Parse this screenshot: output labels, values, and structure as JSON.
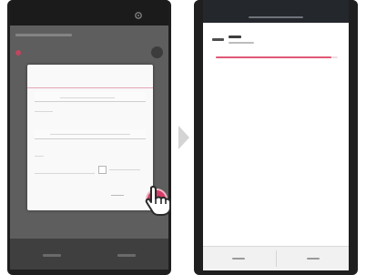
{
  "left_screen": {
    "header_title": "",
    "list_item_label": "",
    "dialog": {
      "title": "",
      "name_value": "",
      "network_label": "",
      "network_value": "",
      "password_label": "",
      "show_password_label": "",
      "cancel_label": ""
    },
    "bottom_left_label": "",
    "bottom_right_label": ""
  },
  "right_screen": {
    "header_subtitle": "",
    "device_logo_text": "",
    "device_name": "",
    "device_status": "",
    "progress": 0.95,
    "bottom_left_label": "",
    "bottom_right_label": ""
  },
  "colors": {
    "accent": "#d43c66",
    "progress_fill": "#e05876",
    "dialog_title": "#c14e66"
  },
  "icons": {
    "hand": "pointing-hand-icon",
    "arrow": "chevron-right-icon",
    "gear": "gear-icon"
  }
}
